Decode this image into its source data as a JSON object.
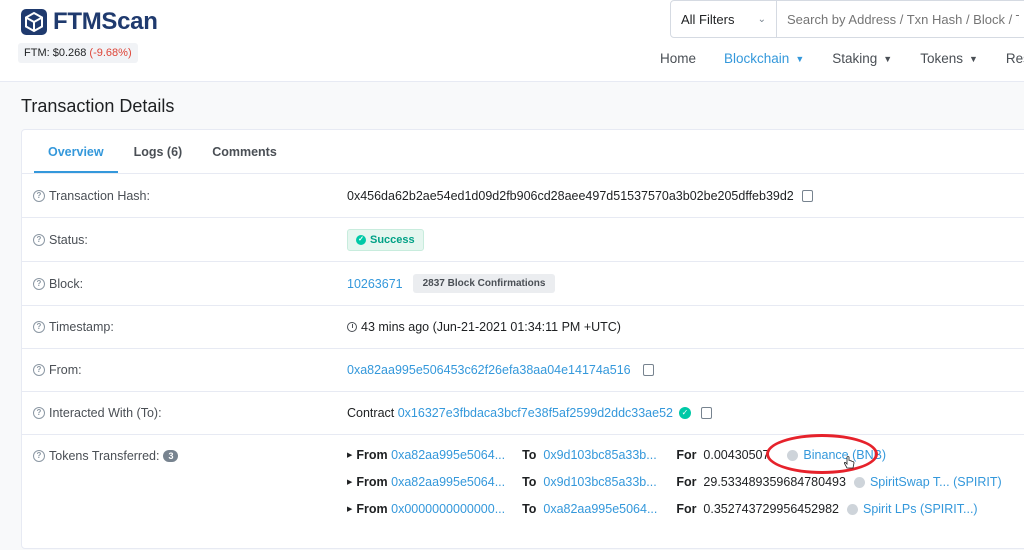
{
  "brand": {
    "name": "FTMScan",
    "price_label": "FTM: $0.268",
    "price_change": "(-9.68%)"
  },
  "search": {
    "filter": "All Filters",
    "placeholder": "Search by Address / Txn Hash / Block / To"
  },
  "nav": {
    "items": [
      "Home",
      "Blockchain",
      "Staking",
      "Tokens",
      "Reso"
    ]
  },
  "page": {
    "title": "Transaction Details"
  },
  "tabs": [
    "Overview",
    "Logs (6)",
    "Comments"
  ],
  "fields": {
    "hash": {
      "label": "Transaction Hash:",
      "value": "0x456da62b2ae54ed1d09d2fb906cd28aee497d51537570a3b02be205dffeb39d2"
    },
    "status": {
      "label": "Status:",
      "value": "Success"
    },
    "block": {
      "label": "Block:",
      "value": "10263671",
      "confirmations": "2837 Block Confirmations"
    },
    "timestamp": {
      "label": "Timestamp:",
      "value": "43 mins ago (Jun-21-2021 01:34:11 PM +UTC)"
    },
    "from": {
      "label": "From:",
      "value": "0xa82aa995e506453c62f26efa38aa04e14174a516"
    },
    "interacted": {
      "label": "Interacted With (To):",
      "prefix": "Contract",
      "value": "0x16327e3fbdaca3bcf7e38f5af2599d2ddc33ae52"
    },
    "tokens": {
      "label": "Tokens Transferred:",
      "count": "3"
    }
  },
  "transfers": [
    {
      "from_lbl": "From",
      "from": "0xa82aa995e5064...",
      "to_lbl": "To",
      "to": "0x9d103bc85a33b...",
      "for_lbl": "For",
      "amount": "0.00430507",
      "token": "Binance (BNB)"
    },
    {
      "from_lbl": "From",
      "from": "0xa82aa995e5064...",
      "to_lbl": "To",
      "to": "0x9d103bc85a33b...",
      "for_lbl": "For",
      "amount": "29.533489359684780493",
      "token": "SpiritSwap T... (SPIRIT)"
    },
    {
      "from_lbl": "From",
      "from": "0x0000000000000...",
      "to_lbl": "To",
      "to": "0xa82aa995e5064...",
      "for_lbl": "For",
      "amount": "0.352743729956452982",
      "token": "Spirit LPs (SPIRIT...)"
    }
  ],
  "colors": {
    "accent": "#3498db",
    "success": "#00c9a7",
    "negative": "#de4437",
    "annotation": "#e6222b"
  }
}
